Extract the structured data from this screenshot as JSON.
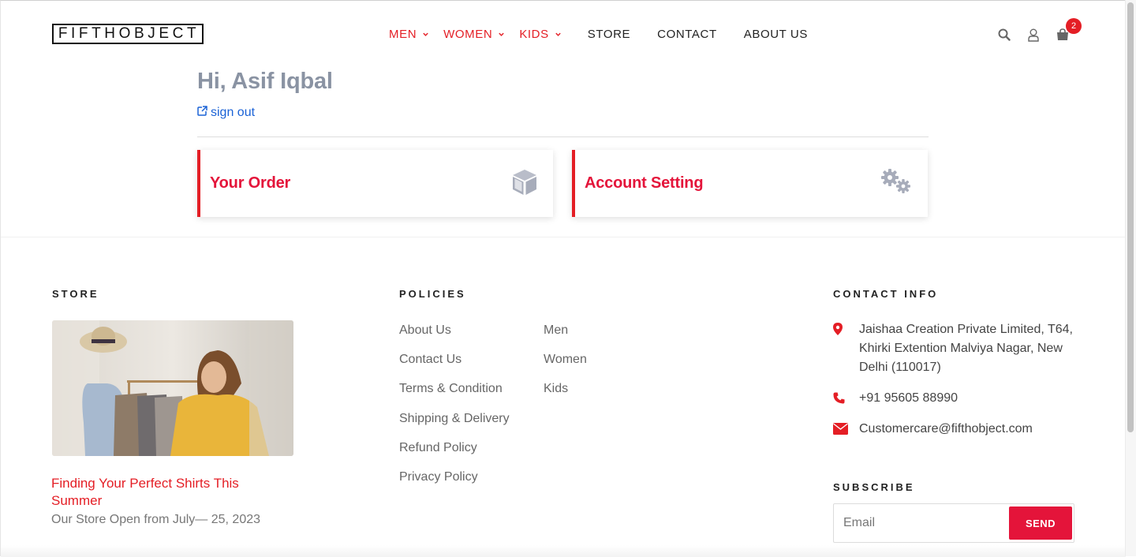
{
  "header": {
    "logo": "FIFTHOBJECT",
    "nav": [
      {
        "label": "MEN",
        "dropdown": true
      },
      {
        "label": "WOMEN",
        "dropdown": true
      },
      {
        "label": "KIDS",
        "dropdown": true
      },
      {
        "label": "STORE",
        "dropdown": false
      },
      {
        "label": "CONTACT",
        "dropdown": false
      },
      {
        "label": "ABOUT US",
        "dropdown": false
      }
    ],
    "icons": [
      "search-icon",
      "user-icon",
      "shopping-bag-icon"
    ],
    "cart_count": "2",
    "accent_color": "#e41e25"
  },
  "account": {
    "greeting": "Hi, Asif Iqbal",
    "signout_label": "sign out",
    "cards": [
      {
        "title": "Your Order",
        "icon": "cube-icon"
      },
      {
        "title": "Account Setting",
        "icon": "gears-icon"
      }
    ]
  },
  "footer": {
    "store": {
      "heading": "STORE",
      "post_title": "Finding Your Perfect Shirts This Summer",
      "post_subtitle": "Our Store Open from July— 25, 2023"
    },
    "policies": {
      "heading": "POLICIES",
      "col1": [
        "About Us",
        "Contact Us",
        "Terms & Condition",
        "Shipping & Delivery",
        "Refund Policy",
        "Privacy Policy"
      ],
      "col2": [
        "Men",
        "Women",
        "Kids"
      ]
    },
    "contact": {
      "heading": "CONTACT INFO",
      "address": "Jaishaa Creation Private Limited, T64, Khirki Extention Malviya Nagar, New Delhi (110017)",
      "phone": "+91 95605 88990",
      "email": "Customercare@fifthobject.com"
    },
    "subscribe": {
      "heading": "SUBSCRIBE",
      "placeholder": "Email",
      "button": "SEND"
    }
  }
}
